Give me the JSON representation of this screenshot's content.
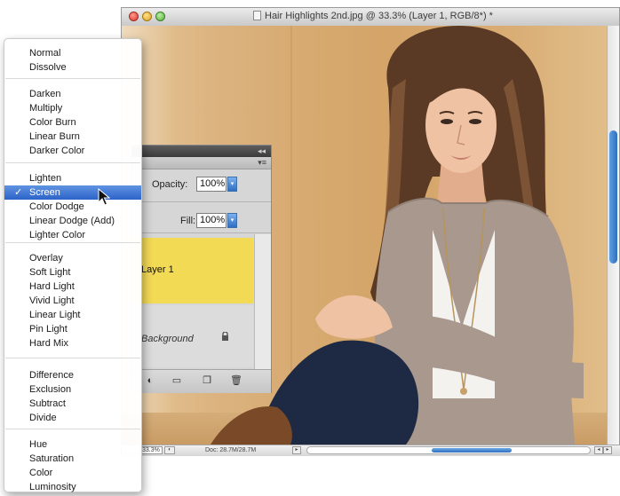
{
  "window": {
    "title": "Hair Highlights 2nd.jpg @ 33.3% (Layer 1, RGB/8*) *"
  },
  "status_bar": {
    "zoom": "33.3%",
    "doc_size": "Doc: 28.7M/28.7M"
  },
  "layers_panel": {
    "opacity_label": "Opacity:",
    "opacity_value": "100%",
    "fill_label": "Fill:",
    "fill_value": "100%",
    "layers": [
      {
        "name": "Layer 1",
        "selected": true,
        "color": "#f3da55"
      },
      {
        "name": "Background",
        "locked": true
      }
    ]
  },
  "blend_menu": {
    "selected": "Screen",
    "groups": [
      [
        "Normal",
        "Dissolve"
      ],
      [
        "Darken",
        "Multiply",
        "Color Burn",
        "Linear Burn",
        "Darker Color"
      ],
      [
        "Lighten",
        "Screen",
        "Color Dodge",
        "Linear Dodge (Add)",
        "Lighter Color"
      ],
      [
        "Overlay",
        "Soft Light",
        "Hard Light",
        "Vivid Light",
        "Linear Light",
        "Pin Light",
        "Hard Mix"
      ],
      [
        "Difference",
        "Exclusion",
        "Subtract",
        "Divide"
      ],
      [
        "Hue",
        "Saturation",
        "Color",
        "Luminosity"
      ]
    ]
  },
  "colors": {
    "selection_blue": "#2c63c9",
    "layer_highlight": "#f3da55",
    "wall": "#d7ab72"
  },
  "icons": [
    "close-icon",
    "minimize-icon",
    "zoom-icon",
    "file-icon",
    "panel-menu-icon",
    "lock-icon",
    "fx-icon",
    "folder-icon",
    "new-layer-icon",
    "trash-icon",
    "cursor-arrow-icon"
  ]
}
